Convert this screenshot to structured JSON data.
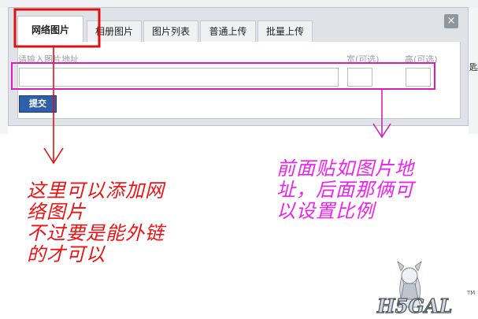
{
  "dialog": {
    "tabs": [
      {
        "label": "网络图片",
        "active": true
      },
      {
        "label": "相册图片"
      },
      {
        "label": "图片列表"
      },
      {
        "label": "普通上传"
      },
      {
        "label": "批量上传"
      }
    ],
    "close_label": "×",
    "form": {
      "url_label": "请输入图片地址",
      "width_label": "宽(可选)",
      "height_label": "高(可选)",
      "url_value": "",
      "width_value": "",
      "height_value": "",
      "submit_label": "提交"
    }
  },
  "background": {
    "right_edge_text": "匙"
  },
  "annotations": {
    "left_note": {
      "lines": [
        "这里可以添加网",
        "络图片",
        "不过要是能外链",
        "的才可以"
      ],
      "color": "#ee1111"
    },
    "right_note": {
      "lines": [
        "前面贴如图片地",
        "址，后面那俩可",
        "以设置比例"
      ],
      "color": "#ee22ee"
    },
    "highlight_colors": {
      "tab_box": "#dd1111",
      "form_box": "#d61fb8"
    }
  },
  "watermark": {
    "text": "H5GAL",
    "tm": "TM"
  }
}
